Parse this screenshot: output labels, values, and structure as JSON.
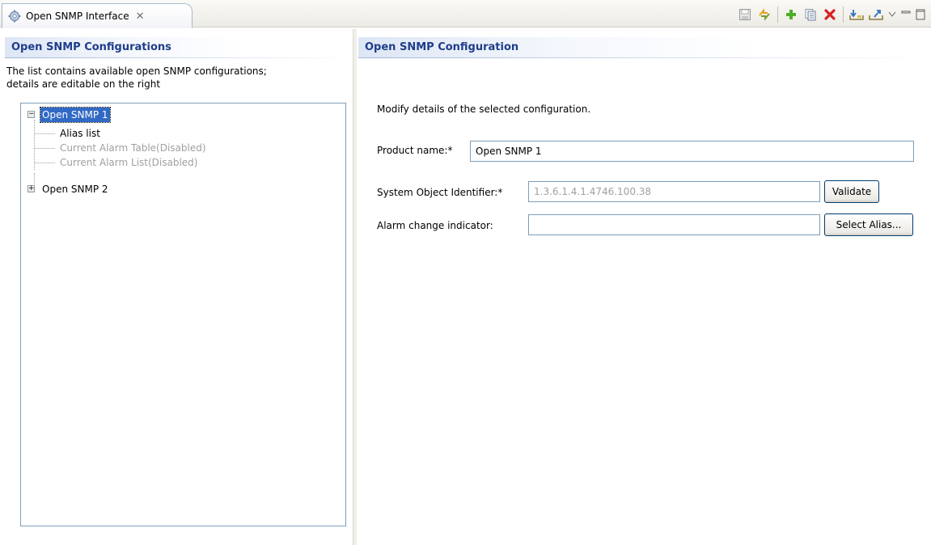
{
  "tab": {
    "title": "Open SNMP Interface",
    "icon": "gear-icon",
    "close": "✕"
  },
  "toolbar": {
    "icons": [
      "save-icon",
      "refresh-icon",
      "add-icon",
      "copy-icon",
      "delete-icon",
      "import-icon",
      "export-icon",
      "view-menu-icon",
      "minimize-icon",
      "maximize-icon"
    ]
  },
  "left": {
    "header": "Open SNMP Configurations",
    "description_line1": "The list contains available open SNMP configurations;",
    "description_line2": "details are editable on the right",
    "tree": {
      "node1": {
        "label": "Open SNMP 1",
        "toggle": "−"
      },
      "children": [
        "Alias list",
        "Current Alarm Table(Disabled)",
        "Current Alarm List(Disabled)"
      ],
      "node2": {
        "label": "Open SNMP 2",
        "toggle": "+"
      }
    }
  },
  "right": {
    "header": "Open SNMP Configuration",
    "description": "Modify details of the selected configuration.",
    "product_name_label": "Product name:*",
    "product_name_value": "Open SNMP 1",
    "sysoid_label": "System Object Identifier:*",
    "sysoid_value": "1.3.6.1.4.1.4746.100.38",
    "validate_button": "Validate",
    "alarm_label": "Alarm change indicator:",
    "alarm_value": "",
    "select_alias_button": "Select Alias..."
  },
  "colors": {
    "header_text": "#1f3d8a",
    "selection": "#316ac5",
    "border": "#7f9db9"
  }
}
